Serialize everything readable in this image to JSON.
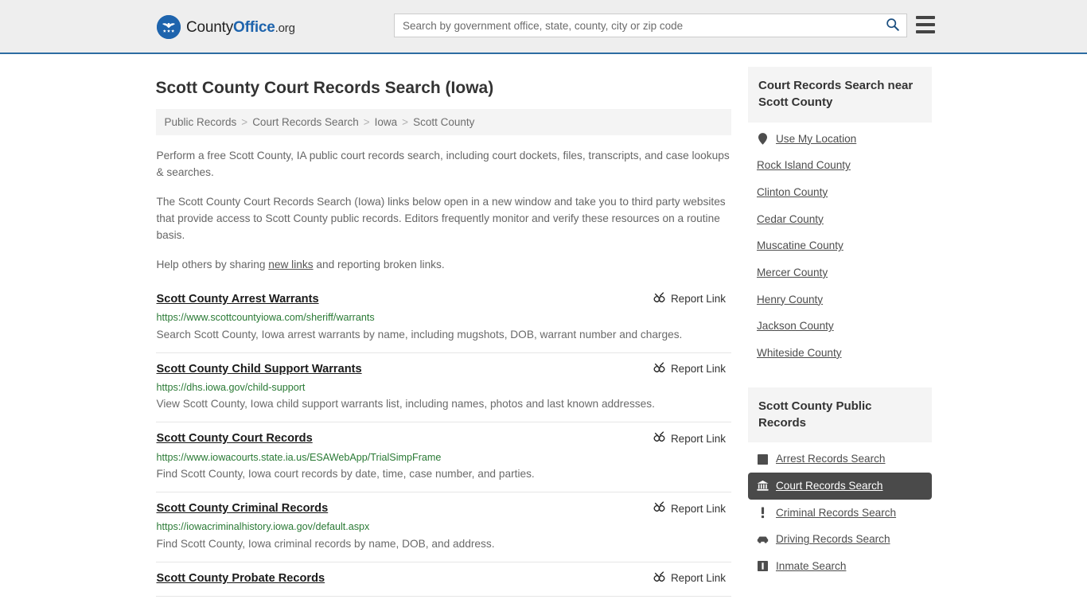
{
  "header": {
    "logo": {
      "part1": "County",
      "part2": "Office",
      "tld": ".org",
      "icon": "eagle-seal-icon"
    },
    "search": {
      "placeholder": "Search by government office, state, county, city or zip code",
      "value": "",
      "button_icon": "search-icon"
    },
    "menu_icon": "hamburger-menu-icon"
  },
  "page": {
    "title": "Scott County Court Records Search (Iowa)"
  },
  "breadcrumb": {
    "separator": ">",
    "items": [
      {
        "label": "Public Records"
      },
      {
        "label": "Court Records Search"
      },
      {
        "label": "Iowa"
      },
      {
        "label": "Scott County"
      }
    ]
  },
  "intro": {
    "p1": "Perform a free Scott County, IA public court records search, including court dockets, files, transcripts, and case lookups & searches.",
    "p2": "The Scott County Court Records Search (Iowa) links below open in a new window and take you to third party websites that provide access to Scott County public records. Editors frequently monitor and verify these resources on a routine basis.",
    "p3_before": "Help others by sharing ",
    "p3_link": "new links",
    "p3_after": " and reporting broken links."
  },
  "results": {
    "report_label": "Report Link",
    "report_icon": "broken-link-icon",
    "items": [
      {
        "title": "Scott County Arrest Warrants",
        "url": "https://www.scottcountyiowa.com/sheriff/warrants",
        "description": "Search Scott County, Iowa arrest warrants by name, including mugshots, DOB, warrant number and charges."
      },
      {
        "title": "Scott County Child Support Warrants",
        "url": "https://dhs.iowa.gov/child-support",
        "description": "View Scott County, Iowa child support warrants list, including names, photos and last known addresses."
      },
      {
        "title": "Scott County Court Records",
        "url": "https://www.iowacourts.state.ia.us/ESAWebApp/TrialSimpFrame",
        "description": "Find Scott County, Iowa court records by date, time, case number, and parties."
      },
      {
        "title": "Scott County Criminal Records",
        "url": "https://iowacriminalhistory.iowa.gov/default.aspx",
        "description": "Find Scott County, Iowa criminal records by name, DOB, and address."
      },
      {
        "title": "Scott County Probate Records",
        "url": "",
        "description": ""
      }
    ]
  },
  "sidebar": {
    "nearby": {
      "heading": "Court Records Search near Scott County",
      "items": [
        {
          "label": "Use My Location",
          "icon": "map-pin-icon"
        },
        {
          "label": "Rock Island County",
          "icon": ""
        },
        {
          "label": "Clinton County",
          "icon": ""
        },
        {
          "label": "Cedar County",
          "icon": ""
        },
        {
          "label": "Muscatine County",
          "icon": ""
        },
        {
          "label": "Mercer County",
          "icon": ""
        },
        {
          "label": "Henry County",
          "icon": ""
        },
        {
          "label": "Jackson County",
          "icon": ""
        },
        {
          "label": "Whiteside County",
          "icon": ""
        }
      ]
    },
    "public_records": {
      "heading": "Scott County Public Records",
      "items": [
        {
          "label": "Arrest Records Search",
          "icon": "fingerprint-icon",
          "active": false
        },
        {
          "label": "Court Records Search",
          "icon": "courthouse-icon",
          "active": true
        },
        {
          "label": "Criminal Records Search",
          "icon": "exclamation-icon",
          "active": false
        },
        {
          "label": "Driving Records Search",
          "icon": "car-icon",
          "active": false
        },
        {
          "label": "Inmate Search",
          "icon": "jail-icon",
          "active": false
        }
      ]
    }
  },
  "colors": {
    "brand_blue": "#1e64ad",
    "header_bg": "#eeeeee",
    "header_border": "#2d6ca2",
    "url_green": "#2a7a35",
    "active_bg": "#4a4a4a",
    "panel_bg": "#f4f4f4"
  }
}
